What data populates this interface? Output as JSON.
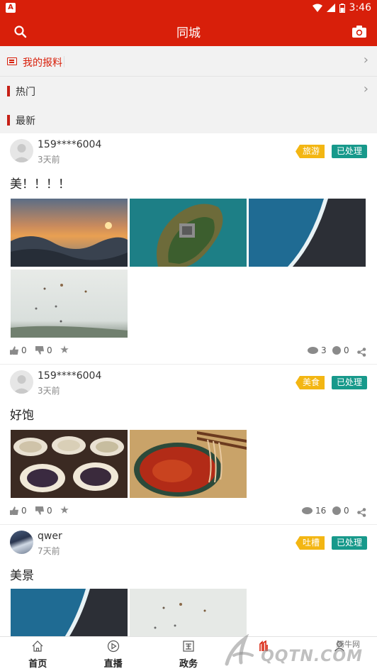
{
  "status_bar": {
    "time": "3:46"
  },
  "app_bar": {
    "title": "同城"
  },
  "rows": {
    "report": "我的报料",
    "hot": "热门",
    "latest": "最新"
  },
  "posts": [
    {
      "username": "159****6004",
      "time": "3天前",
      "category": "旅游",
      "status": "已处理",
      "content": "美！！！！",
      "likes": "0",
      "dislikes": "0",
      "views": "3",
      "comments": "0",
      "images": [
        "sunset-mountains",
        "island-aerial",
        "coast-aerial",
        "hot-air-balloons"
      ]
    },
    {
      "username": "159****6004",
      "time": "3天前",
      "category": "美食",
      "status": "已处理",
      "content": "好饱",
      "likes": "0",
      "dislikes": "0",
      "views": "16",
      "comments": "0",
      "images": [
        "dessert-bowls",
        "noodles-chopsticks"
      ]
    },
    {
      "username": "qwer",
      "time": "7天前",
      "category": "吐槽",
      "status": "已处理",
      "content": "美景",
      "images": [
        "coast-aerial",
        "hot-air-balloons"
      ]
    }
  ],
  "bottom_nav": [
    {
      "label": "首页",
      "icon": "home-icon"
    },
    {
      "label": "直播",
      "icon": "play-icon"
    },
    {
      "label": "政务",
      "icon": "government-icon"
    },
    {
      "label": "",
      "icon": "tongcheng-icon"
    },
    {
      "label": "",
      "icon": "mine-icon"
    }
  ],
  "watermark": {
    "line1": "腾牛网",
    "line2": "QQTN.COM"
  },
  "colors": {
    "brand_red": "#d81f0a",
    "tag_yellow": "#f3b613",
    "status_teal": "#17998b"
  }
}
